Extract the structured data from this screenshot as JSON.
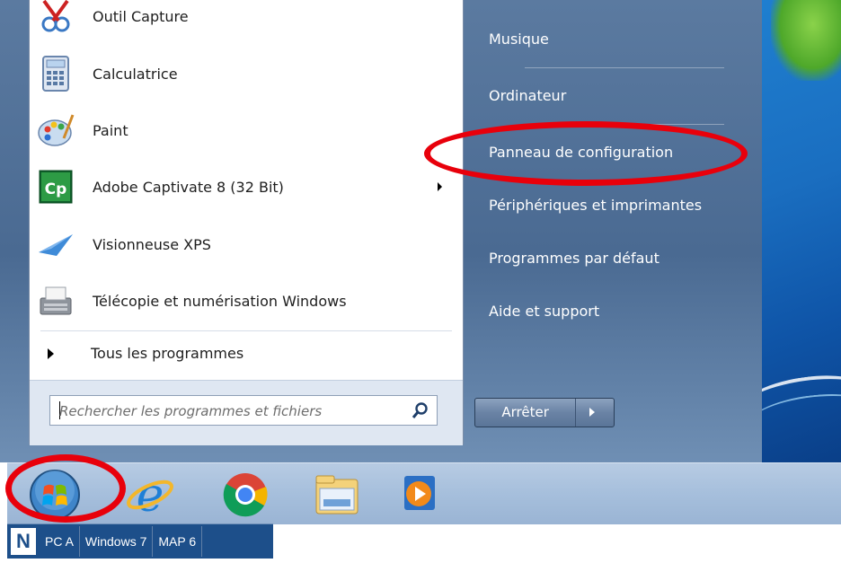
{
  "left_menu": {
    "apps": [
      {
        "label": "Outil Capture",
        "icon": "snipping-tool-icon"
      },
      {
        "label": "Calculatrice",
        "icon": "calculator-icon"
      },
      {
        "label": "Paint",
        "icon": "paint-palette-icon"
      },
      {
        "label": "Adobe Captivate 8 (32 Bit)",
        "icon": "captivate-icon"
      },
      {
        "label": "Visionneuse XPS",
        "icon": "xps-viewer-icon"
      },
      {
        "label": "Télécopie et numérisation Windows",
        "icon": "fax-scan-icon"
      }
    ],
    "all_programs": "Tous les programmes",
    "search_placeholder": "Rechercher les programmes et fichiers"
  },
  "right_menu": {
    "items": [
      "Musique",
      "Ordinateur",
      "Panneau de configuration",
      "Périphériques et imprimantes",
      "Programmes par défaut",
      "Aide et support"
    ],
    "shutdown_label": "Arrêter"
  },
  "taskbar": {
    "pinned": [
      "windows-start-icon",
      "internet-explorer-icon",
      "chrome-icon",
      "file-explorer-icon",
      "media-player-icon"
    ],
    "quick_buttons": [
      "PC A",
      "Windows 7",
      "MAP 6"
    ],
    "quick_logo": "N"
  },
  "colors": {
    "annotation_red": "#e8000b",
    "menu_blue": "#4a6a92",
    "taskbar_blue": "#1d4f8a"
  }
}
